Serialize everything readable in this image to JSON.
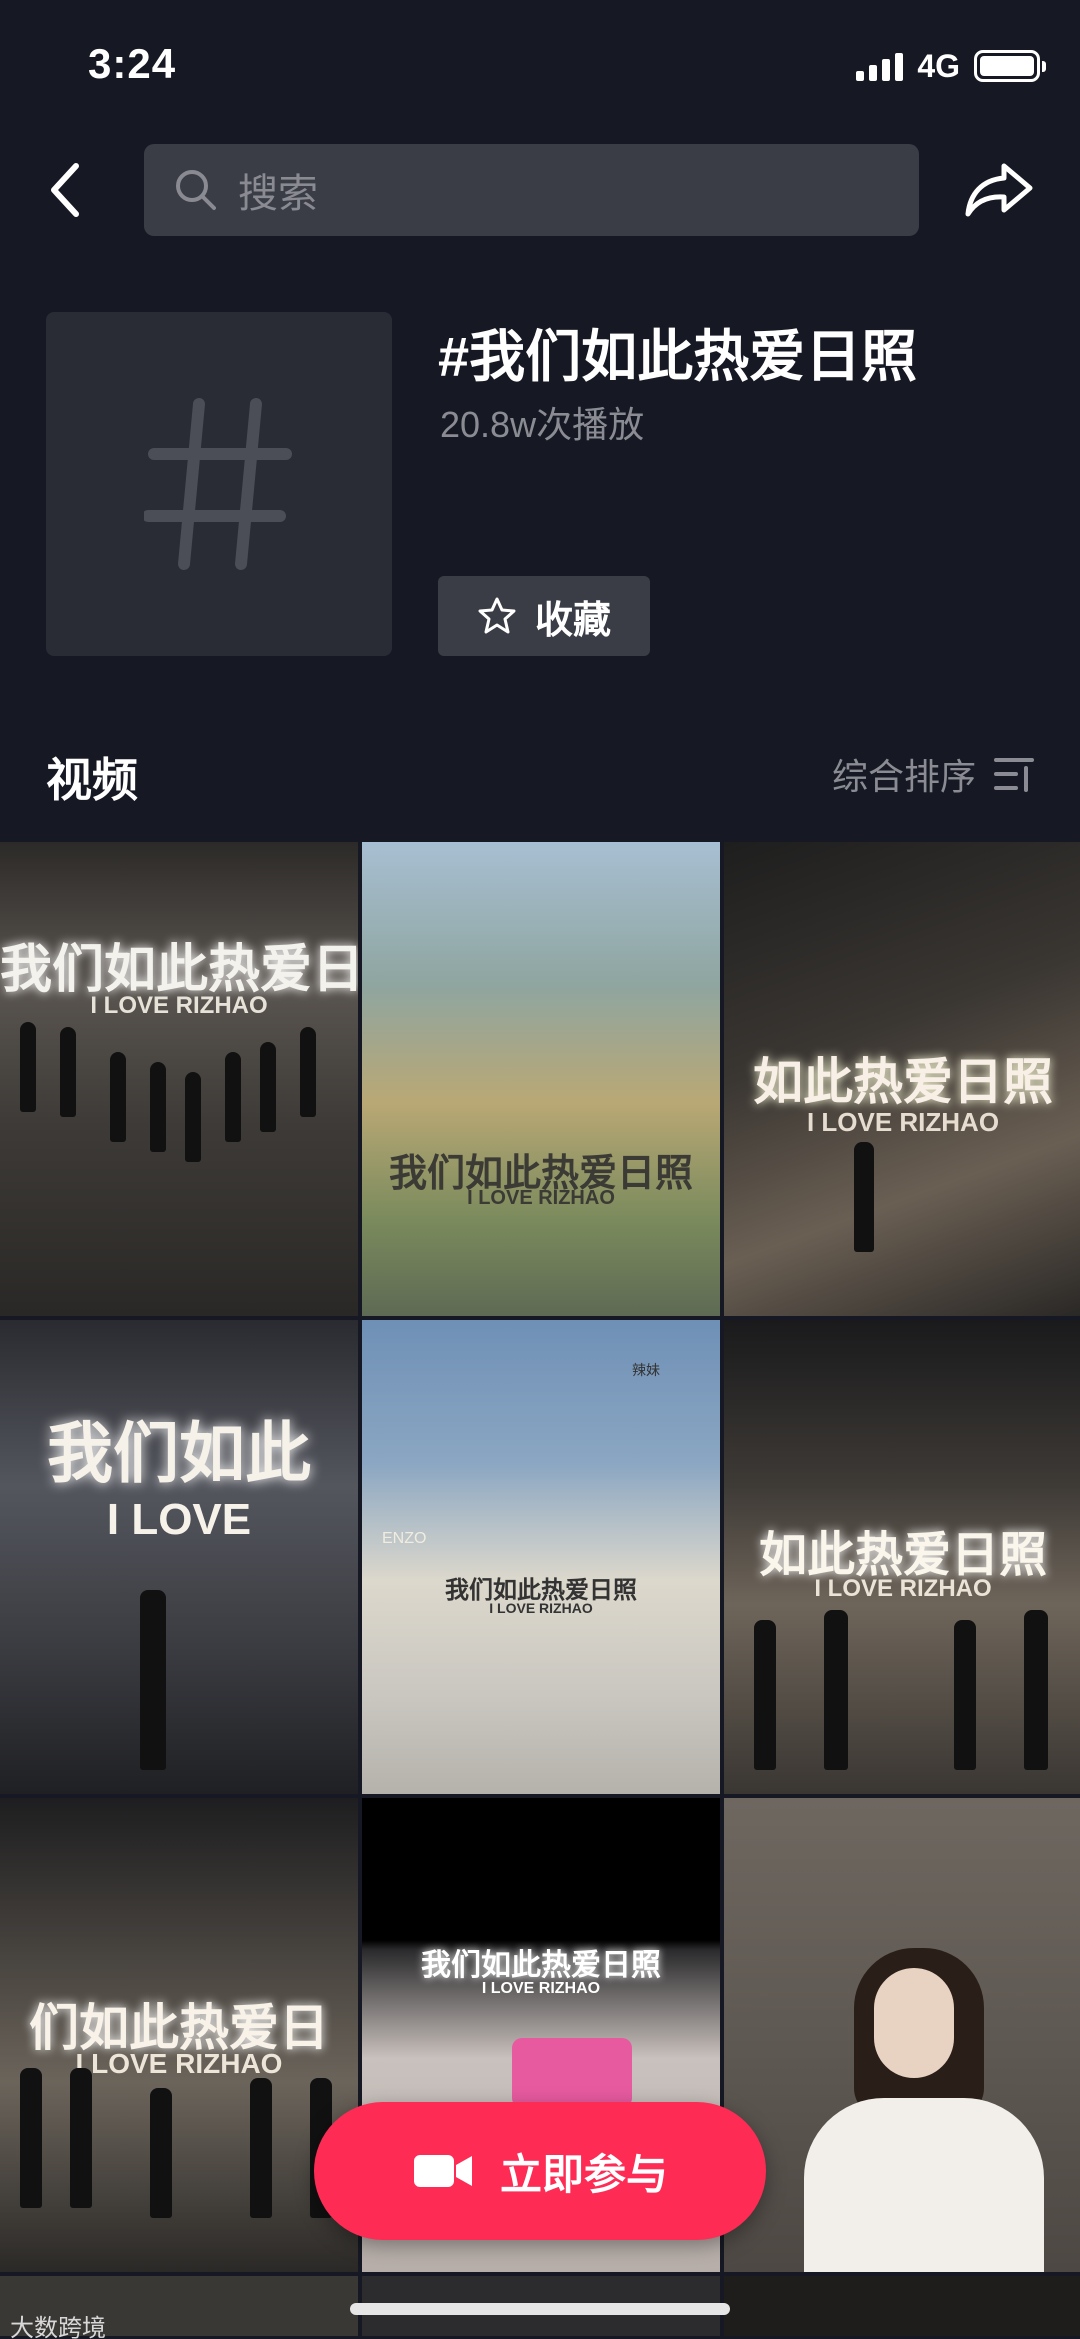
{
  "status_bar": {
    "time": "3:24",
    "network": "4G"
  },
  "nav": {
    "search_placeholder": "搜索",
    "back_icon": "chevron-left-icon",
    "share_icon": "share-arrow-icon"
  },
  "topic": {
    "title": "#我们如此热爱日照",
    "plays": "20.8w次播放",
    "favorite_label": "收藏"
  },
  "section": {
    "title": "视频",
    "sort_label": "综合排序"
  },
  "videos": [
    {
      "overlay": "我们如此热爱日",
      "sub": "I LOVE RIZHAO"
    },
    {
      "overlay": "我们如此热爱日照",
      "sub": "I LOVE RIZHAO"
    },
    {
      "overlay": "如此热爱日照",
      "sub": "I LOVE RIZHAO"
    },
    {
      "overlay": "我们如此",
      "sub": "I LOVE"
    },
    {
      "overlay": "我们如此热爱日照",
      "sub": "I LOVE RIZHAO",
      "sign1": "ENZO",
      "sign2": "辣妹"
    },
    {
      "overlay": "如此热爱日照",
      "sub": "I LOVE RIZHAO"
    },
    {
      "overlay": "们如此热爱日",
      "sub": "I LOVE RIZHAO"
    },
    {
      "overlay": "我们如此热爱日照",
      "sub": "I LOVE RIZHAO"
    },
    {
      "overlay": "",
      "sub": ""
    }
  ],
  "join_button": {
    "label": "立即参与"
  },
  "watermark": "大数跨境",
  "colors": {
    "background": "#161823",
    "accent": "#fe2c55",
    "muted_text": "#8b8c93",
    "surface": "#3a3c46"
  }
}
